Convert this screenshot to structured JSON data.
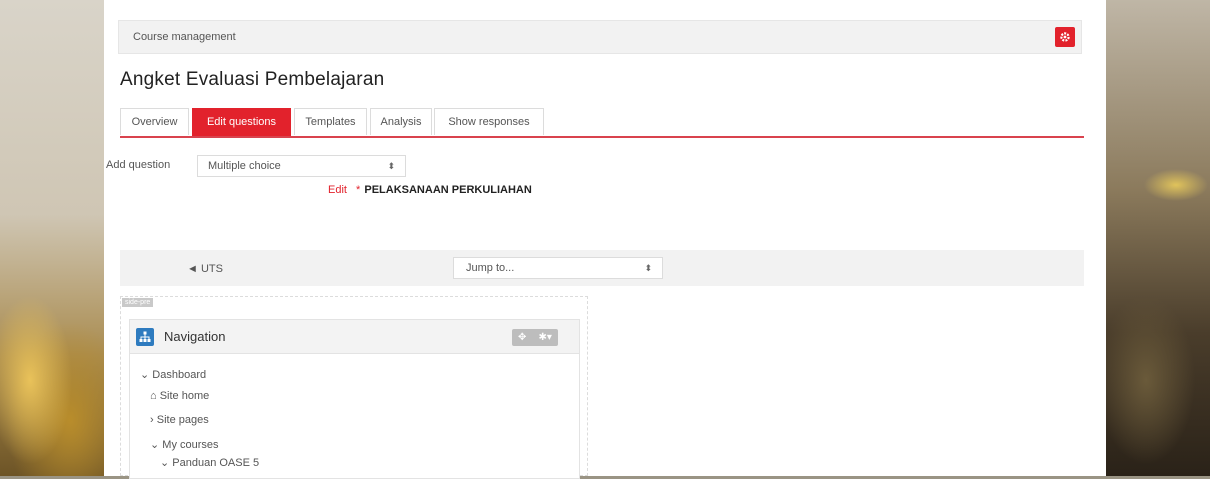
{
  "header": {
    "course_management": "Course management",
    "settings_icon": "gear-icon",
    "accent": "#e2222c"
  },
  "page_title": "Angket Evaluasi Pembelajaran",
  "tabs": [
    {
      "label": "Overview",
      "active": false
    },
    {
      "label": "Edit questions",
      "active": true
    },
    {
      "label": "Templates",
      "active": false
    },
    {
      "label": "Analysis",
      "active": false
    },
    {
      "label": "Show responses",
      "active": false
    }
  ],
  "add_question": {
    "label": "Add question",
    "selected": "Multiple choice"
  },
  "edit_line": {
    "edit": "Edit",
    "star": "*",
    "section": "PELAKSANAAN PERKULIAHAN"
  },
  "pager": {
    "prev_label": "◄ UTS",
    "jump_placeholder": "Jump to..."
  },
  "block_region": {
    "tag": "side-pre"
  },
  "navigation": {
    "title": "Navigation",
    "icon": "sitemap-icon",
    "items": [
      {
        "label": "Dashboard",
        "prefix": "⌄"
      },
      {
        "label": "Site home",
        "prefix": "⌂"
      },
      {
        "label": "Site pages",
        "prefix": "›"
      },
      {
        "label": "My courses",
        "prefix": "⌄"
      },
      {
        "label": "Panduan OASE 5",
        "prefix": "⌄"
      }
    ]
  }
}
